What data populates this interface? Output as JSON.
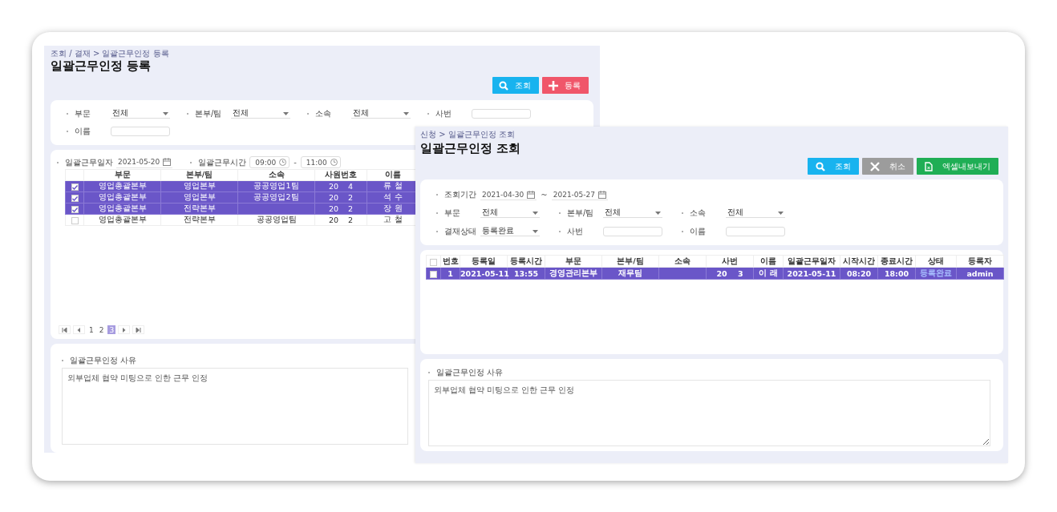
{
  "registration_window": {
    "breadcrumb": "조회 / 결재 > 일괄근무인정 등록",
    "title": "일괄근무인정 등록",
    "buttons": [
      {
        "label": "조회",
        "kind": "search"
      },
      {
        "label": "등록",
        "kind": "add"
      }
    ],
    "filters": [
      {
        "label": "부문",
        "kind": "select",
        "value": "전체"
      },
      {
        "label": "본부/팀",
        "kind": "select",
        "value": "전체"
      },
      {
        "label": "소속",
        "kind": "select",
        "value": "전체"
      },
      {
        "label": "사번",
        "kind": "text"
      },
      {
        "label": "이름",
        "kind": "text"
      }
    ],
    "work_date": {
      "label": "일괄근무일자",
      "value": "2021-05-20"
    },
    "work_time": {
      "label": "일괄근무시간",
      "start": "09:00",
      "separator": "-",
      "end": "11:00"
    },
    "table": {
      "columns": [
        "부문",
        "본부/팀",
        "소속",
        "사원번호",
        "이름"
      ],
      "rows": [
        {
          "selected": true,
          "checked": true,
          "cells": [
            "영업총괄본부",
            "영업본부",
            "공공영업1팀",
            "20    4",
            "류 철"
          ]
        },
        {
          "selected": true,
          "checked": true,
          "cells": [
            "영업총괄본부",
            "영업본부",
            "공공영업2팀",
            "20    2",
            "석 수"
          ]
        },
        {
          "selected": true,
          "checked": true,
          "cells": [
            "영업총괄본부",
            "전략본부",
            "",
            "20    2",
            "장 원"
          ]
        },
        {
          "selected": false,
          "checked": false,
          "cells": [
            "영업총괄본부",
            "전략본부",
            "공공영업팀",
            "20    2",
            "고 철"
          ]
        }
      ]
    },
    "pagination": [
      {
        "kind": "first"
      },
      {
        "kind": "prev"
      },
      {
        "kind": "page",
        "label": "1",
        "selected": false
      },
      {
        "kind": "page",
        "label": "2",
        "selected": false
      },
      {
        "kind": "page",
        "label": "3",
        "selected": true
      },
      {
        "kind": "next"
      },
      {
        "kind": "last"
      }
    ],
    "reason": {
      "label": "일괄근무인정 사유",
      "value": "외부업체 협약 미팅으로 인한 근무 인정"
    }
  },
  "inquiry_window": {
    "breadcrumb": "신청 > 일괄근무인정 조회",
    "title": "일괄근무인정 조회",
    "buttons": [
      {
        "label": "조회",
        "kind": "search"
      },
      {
        "label": "취소",
        "kind": "cancel"
      },
      {
        "label": "엑셀내보내기",
        "kind": "excel"
      }
    ],
    "period": {
      "label": "조회기간",
      "start": "2021-04-30",
      "separator": "~",
      "end": "2021-05-27"
    },
    "filters": [
      {
        "label": "부문",
        "kind": "select",
        "value": "전체"
      },
      {
        "label": "본부/팀",
        "kind": "select",
        "value": "전체"
      },
      {
        "label": "소속",
        "kind": "select",
        "value": "전체"
      },
      {
        "label": "결재상태",
        "kind": "select",
        "value": "등록완료"
      },
      {
        "label": "사번",
        "kind": "text"
      },
      {
        "label": "이름",
        "kind": "text"
      }
    ],
    "table": {
      "header_checked": false,
      "columns": [
        "번호",
        "등록일",
        "등록시간",
        "부문",
        "본부/팀",
        "소속",
        "사번",
        "이름",
        "일괄근무일자",
        "시작시간",
        "종료시간",
        "상태",
        "등록자"
      ],
      "rows": [
        {
          "selected": true,
          "checked": false,
          "cells": [
            "1",
            "2021-05-11",
            "13:55",
            "경영관리본부",
            "재무팀",
            "",
            "20    3",
            "이 래",
            "2021-05-11",
            "08:20",
            "18:00",
            "등록완료",
            "admin"
          ]
        }
      ]
    },
    "reason": {
      "label": "일괄근무인정 사유",
      "value": "외부업체 협약 미팅으로 인한 근무 인정"
    }
  }
}
